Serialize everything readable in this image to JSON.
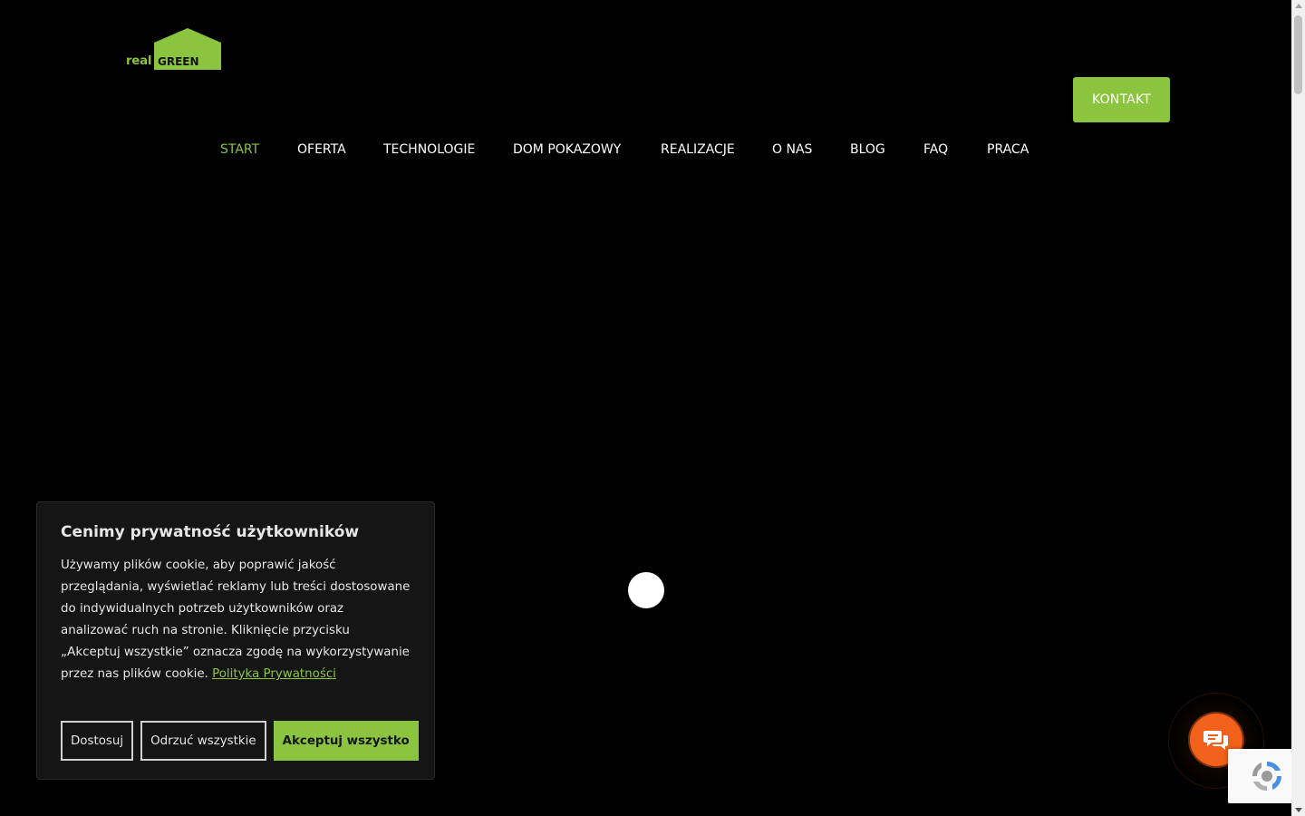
{
  "brand": {
    "logo_real": "real",
    "logo_green": "GREEN",
    "accent_color": "#8bc43f"
  },
  "header": {
    "contact_label": "KONTAKT"
  },
  "nav": {
    "items": [
      {
        "label": "START",
        "active": true
      },
      {
        "label": "OFERTA",
        "active": false
      },
      {
        "label": "TECHNOLOGIE",
        "active": false
      },
      {
        "label": "DOM POKAZOWY",
        "active": false
      },
      {
        "label": "REALIZACJE",
        "active": false
      },
      {
        "label": "O NAS",
        "active": false
      },
      {
        "label": "BLOG",
        "active": false
      },
      {
        "label": "FAQ",
        "active": false
      },
      {
        "label": "PRACA",
        "active": false
      }
    ]
  },
  "cookie": {
    "title": "Cenimy prywatność użytkowników",
    "body": "Używamy plików cookie, aby poprawić jakość przeglądania, wyświetlać reklamy lub treści dostosowane do indywidualnych potrzeb użytkowników oraz analizować ruch na stronie. Kliknięcie przycisku „Akceptuj wszystkie” oznacza zgodę na wykorzystywanie przez nas plików cookie.",
    "policy_link": "Polityka Prywatności",
    "customize_label": "Dostosuj",
    "reject_label": "Odrzuć wszystkie",
    "accept_label": "Akceptuj wszystko"
  },
  "widgets": {
    "chat_icon": "chat-bubbles-icon",
    "chat_color": "#f2611c",
    "recaptcha_icon": "recaptcha-icon"
  }
}
